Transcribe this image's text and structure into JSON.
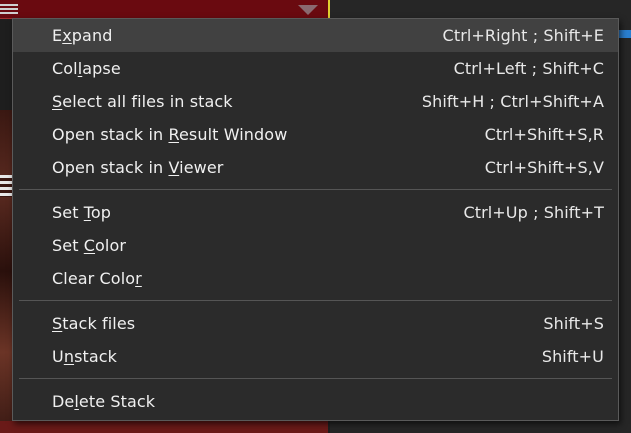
{
  "menu": {
    "groups": [
      {
        "items": [
          {
            "pre": "E",
            "acc": "x",
            "post": "pand",
            "shortcut": "Ctrl+Right ; Shift+E",
            "active": true
          },
          {
            "pre": "Col",
            "acc": "l",
            "post": "apse",
            "shortcut": "Ctrl+Left ; Shift+C"
          },
          {
            "pre": "",
            "acc": "S",
            "post": "elect all files in stack",
            "shortcut": "Shift+H ; Ctrl+Shift+A"
          },
          {
            "pre": "Open stack in ",
            "acc": "R",
            "post": "esult Window",
            "shortcut": "Ctrl+Shift+S,R"
          },
          {
            "pre": "Open stack in ",
            "acc": "V",
            "post": "iewer",
            "shortcut": "Ctrl+Shift+S,V"
          }
        ]
      },
      {
        "items": [
          {
            "pre": "Set ",
            "acc": "T",
            "post": "op",
            "shortcut": "Ctrl+Up ; Shift+T"
          },
          {
            "pre": "Set ",
            "acc": "C",
            "post": "olor",
            "shortcut": ""
          },
          {
            "pre": "Clear Colo",
            "acc": "r",
            "post": "",
            "shortcut": ""
          }
        ]
      },
      {
        "items": [
          {
            "pre": "",
            "acc": "S",
            "post": "tack files",
            "shortcut": "Shift+S"
          },
          {
            "pre": "U",
            "acc": "n",
            "post": "stack",
            "shortcut": "Shift+U"
          }
        ]
      },
      {
        "items": [
          {
            "pre": "De",
            "acc": "l",
            "post": "ete Stack",
            "shortcut": ""
          }
        ]
      }
    ]
  },
  "colors": {
    "menu_bg": "#2b2b2b",
    "hover_bg": "#414141",
    "text": "#f0f0f0",
    "separator": "#555555"
  }
}
